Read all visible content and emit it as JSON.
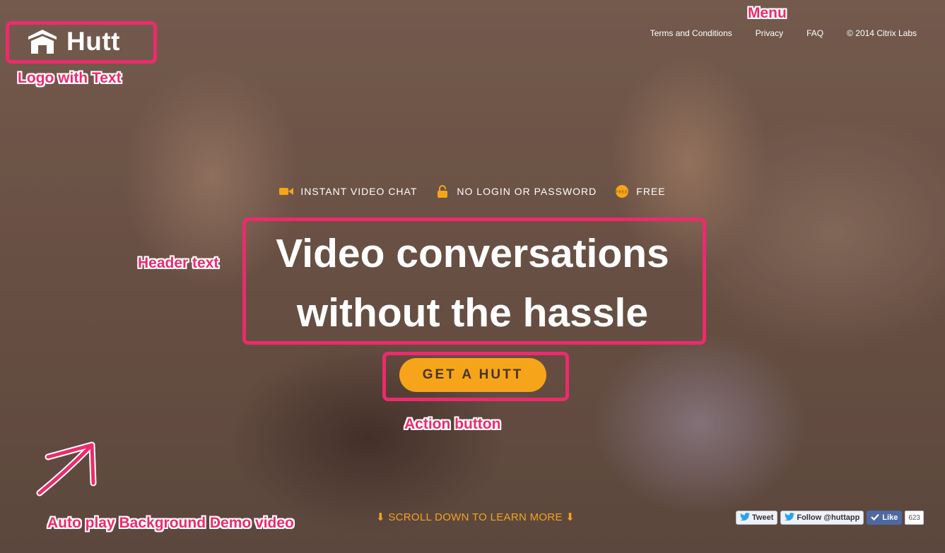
{
  "app": {
    "logo_text": "Hutt"
  },
  "nav": {
    "items": [
      "Terms and Conditions",
      "Privacy",
      "FAQ"
    ],
    "copyright": "© 2014 Citrix Labs"
  },
  "features": [
    {
      "icon": "video-camera-icon",
      "label": "INSTANT VIDEO CHAT"
    },
    {
      "icon": "lock-icon",
      "label": "NO LOGIN OR PASSWORD"
    },
    {
      "icon": "free-badge-icon",
      "label": "FREE",
      "icon_text": "FREE"
    }
  ],
  "headline": {
    "line1": "Video conversations",
    "line2": "without the hassle"
  },
  "cta": {
    "label": "GET A HUTT"
  },
  "scroll_hint": "⬇ SCROLL DOWN TO LEARN MORE ⬇",
  "social": {
    "tweet": "Tweet",
    "follow": "Follow @huttapp",
    "like": "Like",
    "like_count": "623"
  },
  "annotations": {
    "menu": "Menu",
    "logo": "Logo with Text",
    "header": "Header text",
    "action": "Action button",
    "video": "Auto play Background Demo video"
  },
  "colors": {
    "accent": "#f6a51a",
    "annotation": "#ee2a6d",
    "scroll_text": "#f2a421",
    "facebook": "#4e69a2"
  }
}
